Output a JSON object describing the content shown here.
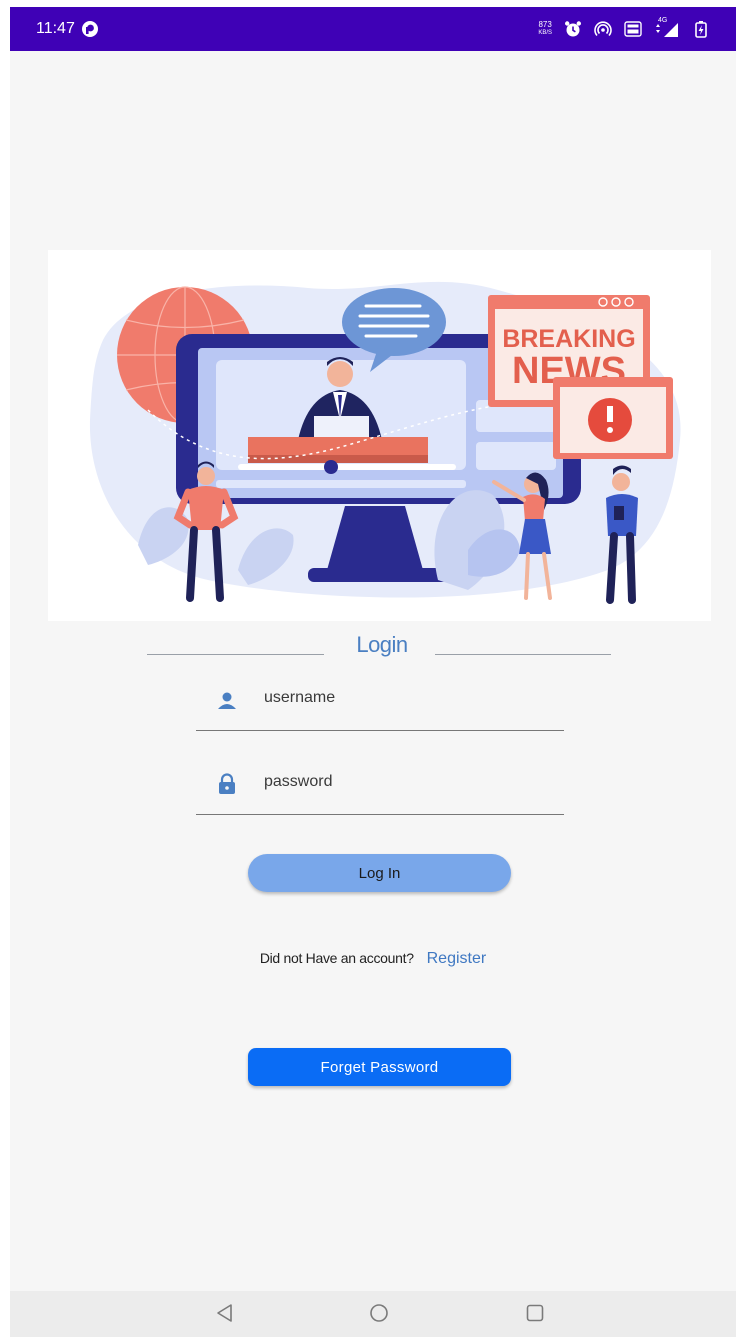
{
  "status_bar": {
    "time": "11:47",
    "net_speed_value": "873",
    "net_speed_unit": "KB/S",
    "signal_label": "4G",
    "icons": [
      "notification-app-icon",
      "alarm-icon",
      "hotspot-icon",
      "volte-icon",
      "signal-icon",
      "battery-icon"
    ],
    "background": "#3f01b6"
  },
  "hero": {
    "sign_line1": "BREAKING",
    "sign_line2": "NEWS"
  },
  "login": {
    "title": "Login",
    "username_placeholder": "username",
    "password_placeholder": "password",
    "login_button": "Log In",
    "register_prompt": "Did not Have an account?",
    "register_link": "Register",
    "forget_button": "Forget Password"
  },
  "colors": {
    "title": "#4a7fc2",
    "login_button": "#79a7ea",
    "forget_button": "#0a6cf5",
    "link": "#3f78c2"
  },
  "nav_bar": {
    "icons": [
      "back-icon",
      "home-icon",
      "recents-icon"
    ]
  }
}
